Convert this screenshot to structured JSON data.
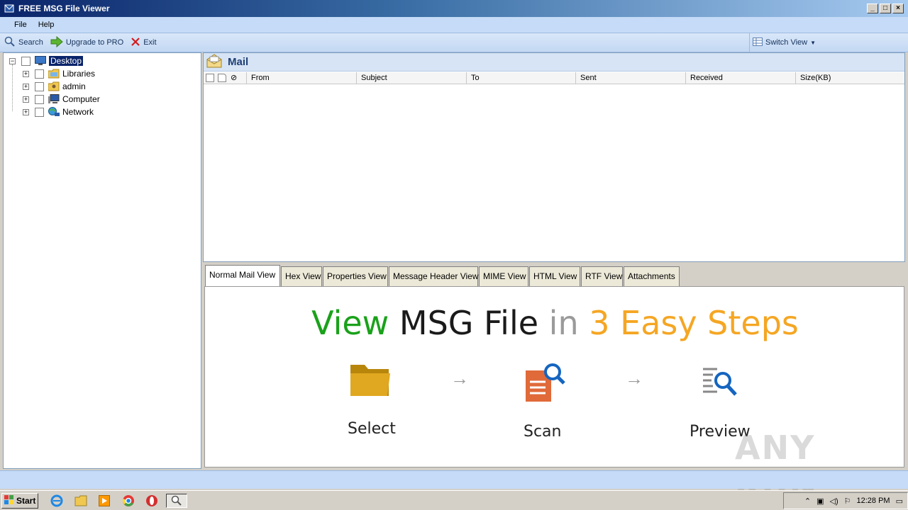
{
  "window": {
    "title": "FREE MSG File Viewer"
  },
  "menu": {
    "items": [
      "File",
      "Help"
    ]
  },
  "toolbar": {
    "search_label": "Search",
    "upgrade_label": "Upgrade to PRO",
    "exit_label": "Exit",
    "switch_view_label": "Switch View"
  },
  "tree": {
    "root": "Desktop",
    "children": [
      "Libraries",
      "admin",
      "Computer",
      "Network"
    ]
  },
  "mail": {
    "title": "Mail",
    "columns": [
      "From",
      "Subject",
      "To",
      "Sent",
      "Received",
      "Size(KB)"
    ]
  },
  "tabs": [
    "Normal Mail View",
    "Hex View",
    "Properties View",
    "Message Header View",
    "MIME View",
    "HTML View",
    "RTF View",
    "Attachments"
  ],
  "preview": {
    "headline": {
      "part1": "View",
      "part2": "MSG File",
      "part3": "in",
      "part4": "3 Easy Steps"
    },
    "steps": [
      "Select",
      "Scan",
      "Preview"
    ],
    "colors": {
      "green": "#1aa11a",
      "dark": "#1a1a1a",
      "gray": "#9a9a9a",
      "orange": "#f5a623"
    }
  },
  "taskbar": {
    "start_label": "Start",
    "clock": "12:28 PM"
  },
  "watermark": "ANY RUN"
}
